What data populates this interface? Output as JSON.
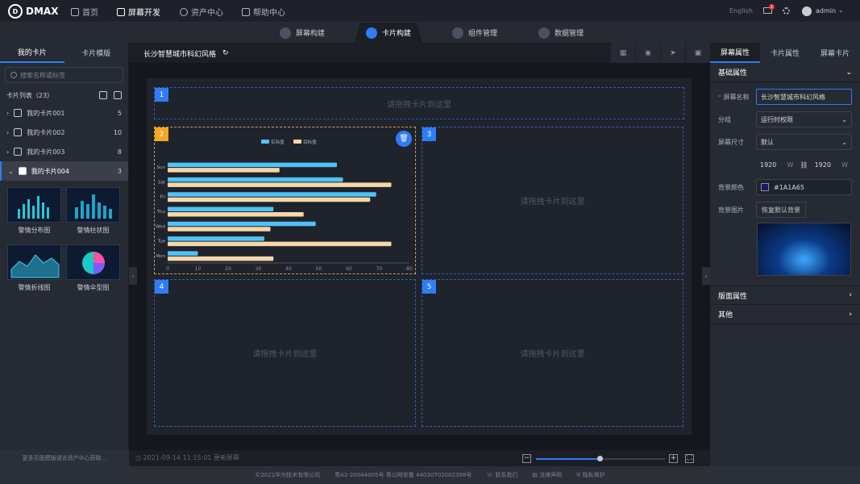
{
  "app": {
    "name": "DMAX"
  },
  "topnav": {
    "items": [
      {
        "label": "首页"
      },
      {
        "label": "屏幕开发"
      },
      {
        "label": "资产中心"
      },
      {
        "label": "帮助中心"
      }
    ],
    "language": "English",
    "mail_badge": "1",
    "user": "admin"
  },
  "subnav": {
    "items": [
      {
        "label": "屏幕构建"
      },
      {
        "label": "卡片构建"
      },
      {
        "label": "组件管理"
      },
      {
        "label": "数据管理"
      }
    ]
  },
  "left": {
    "tabs": [
      "我的卡片",
      "卡片模版"
    ],
    "search_placeholder": "搜索名称或标签",
    "list_title": "卡片列表（23）",
    "folders": [
      {
        "name": "我的卡片001",
        "count": "5"
      },
      {
        "name": "我的卡片002",
        "count": "10"
      },
      {
        "name": "我的卡片003",
        "count": "8"
      },
      {
        "name": "我的卡片004",
        "count": "3"
      }
    ],
    "thumbs": [
      {
        "label": "警情分布图"
      },
      {
        "label": "警情柱状图"
      },
      {
        "label": "警情折线图"
      },
      {
        "label": "警情伞型图"
      }
    ],
    "footer": "更多页面模版请去资产中心获取..."
  },
  "editor": {
    "title": "长沙智慧城市科幻风格",
    "status": "2021-09-14 11:15:01 更新屏幕",
    "slots": [
      {
        "num": "1",
        "hint": "请拖拽卡片到这里"
      },
      {
        "num": "2",
        "hint": ""
      },
      {
        "num": "3",
        "hint": "请拖拽卡片到这里"
      },
      {
        "num": "4",
        "hint": "请拖拽卡片到这里"
      },
      {
        "num": "5",
        "hint": "请拖拽卡片到这里"
      }
    ]
  },
  "chart_data": {
    "type": "bar",
    "orientation": "horizontal",
    "categories": [
      "Mon",
      "Tue",
      "Wed",
      "Thu",
      "Fri",
      "Sat",
      "Sun"
    ],
    "series": [
      {
        "name": "实际值",
        "color": "#4fc3f7",
        "values": [
          10,
          32,
          49,
          35,
          69,
          58,
          56
        ]
      },
      {
        "name": "目标值",
        "color": "#f5d7a8",
        "values": [
          35,
          74,
          34,
          45,
          67,
          74,
          37
        ]
      }
    ],
    "xlim": [
      0,
      80
    ],
    "xticks": [
      "0",
      "10",
      "20",
      "30",
      "40",
      "50",
      "60",
      "70",
      "80"
    ]
  },
  "right": {
    "tabs": [
      "屏幕属性",
      "卡片属性",
      "屏幕卡片"
    ],
    "section_basic": "基础属性",
    "name_label": "屏幕名称",
    "name_value": "长沙智慧城市科幻风格",
    "group_label": "分组",
    "group_value": "运行时权限",
    "size_label": "屏幕尺寸",
    "size_value": "默认",
    "width": "1920",
    "height": "1920",
    "w_unit": "W",
    "h_unit": "W",
    "bgcolor_label": "背景颜色",
    "bgcolor_value": "#1A1A65",
    "bgimage_label": "背景图片",
    "reset_bg": "恢复默认背景",
    "section_layout": "版面属性",
    "section_other": "其他"
  },
  "footer": {
    "copyright": "©2021华为技术有限公司",
    "icp": "粤A2-20044005号 粤公网安备 44030702002388号",
    "contact": "联系我们",
    "legal": "法律声明",
    "privacy": "隐私保护"
  }
}
